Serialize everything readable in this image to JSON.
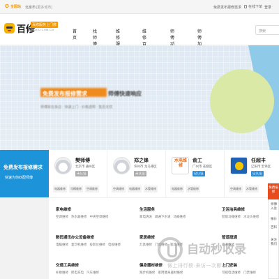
{
  "topbar": {
    "location_label": "全国站",
    "city": "北京市",
    "switch_city": "[更多城市]",
    "publish_link": "免费发布报修需求",
    "download": "在线下单",
    "login": "登录"
  },
  "header": {
    "brand": "百修",
    "brand_tag": "百修服务上门修",
    "brand_sub": "BAIXIU.COM.CN",
    "nav": [
      "首页",
      "找师傅",
      "维修服务",
      "维修百科",
      "师傅动态",
      "师傅加盟"
    ],
    "search_placeholder": "搜索"
  },
  "banner": {
    "headline_box": "免费发布报修需求",
    "headline_right": "师傅快速响应",
    "subline": "师傅就在身边 · 快速上门 · 价格透明 · 售后无忧"
  },
  "publish": {
    "title": "免费发布报修需求",
    "link": "快速为你匹配师傅"
  },
  "masters": [
    {
      "name": "樊师傅",
      "area": "北京市 通州区",
      "badge": "未认证",
      "tags": [
        "电器维修",
        "马桶维修",
        "空调维修"
      ],
      "avatar": "default"
    },
    {
      "name": "郑之锋",
      "area": "许州市 龙马潭区",
      "badge": "未认证",
      "tags": [
        "空调维修",
        "电器维修",
        "水管维修"
      ],
      "avatar": "default"
    },
    {
      "name": "俞工",
      "area": "广州市 花都区",
      "badge": "已认证",
      "tags": [
        "电器维修",
        "水管维修"
      ],
      "avatar": "logo",
      "logo_text": "水电维修"
    },
    {
      "name": "任超丰",
      "area": "辽阳市 宏伟区",
      "badge": "已认证",
      "tags": [
        "空调维修",
        "水管维修"
      ],
      "avatar": "blue"
    }
  ],
  "float_tab": {
    "hot": "免费报修",
    "items": [
      "师傅入驻",
      "报价",
      "百科",
      "关注我们"
    ]
  },
  "categories": [
    {
      "title": "家电维修",
      "items": [
        "空调维修",
        "热水器维修",
        "中央空调维修"
      ]
    },
    {
      "title": "生活服务",
      "items": [
        "家电清洗",
        "疏通下水道",
        "马桶维修"
      ]
    },
    {
      "title": "卫浴洁具维修",
      "items": [
        "智能马桶维修",
        "水龙头维修",
        "台盆维修"
      ]
    },
    {
      "title": "数码通讯办公设备维修",
      "items": [
        "电脑维修",
        "复印机维修",
        "投影仪维修",
        "电视维修"
      ]
    },
    {
      "title": "家居维修",
      "items": [
        "灯具维修",
        "门窗维修",
        "家具维修"
      ]
    },
    {
      "title": "管道疏通",
      "items": [
        "疏通维修"
      ]
    },
    {
      "title": "交通工具维修",
      "items": [
        "补胎维修",
        "摇电充电",
        "汽车维修"
      ]
    },
    {
      "title": "健身器材维修",
      "items": [
        "跑步机维修",
        "家用健身器材维修"
      ]
    },
    {
      "title": "上门安装",
      "items": [
        "可视电话维修",
        "门禁维修"
      ]
    }
  ],
  "watermark": {
    "text": "自动秒收录",
    "sub": "做上排行榜·来访一次即收录"
  }
}
